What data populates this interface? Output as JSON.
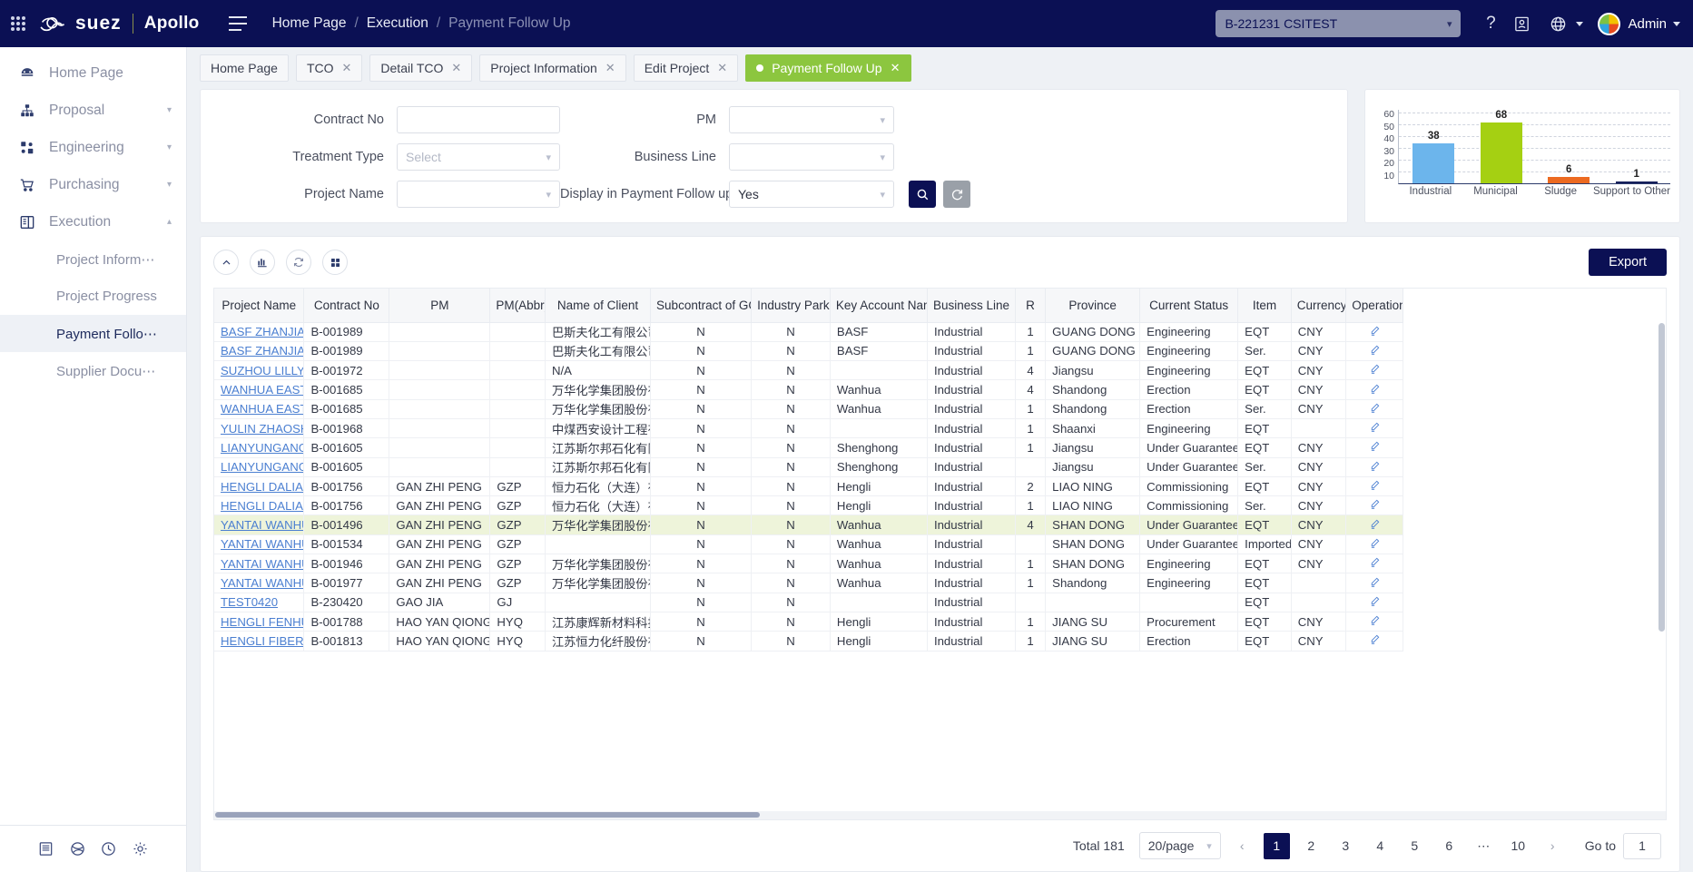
{
  "header": {
    "brand_suez": "suez",
    "brand_apollo": "Apollo",
    "breadcrumb": [
      "Home Page",
      "Execution",
      "Payment Follow Up"
    ],
    "project_selector": "B-221231 CSITEST",
    "user_name": "Admin"
  },
  "tabs": [
    {
      "label": "Home Page",
      "closable": false,
      "active": false
    },
    {
      "label": "TCO",
      "closable": true,
      "active": false
    },
    {
      "label": "Detail TCO",
      "closable": true,
      "active": false
    },
    {
      "label": "Project Information",
      "closable": true,
      "active": false
    },
    {
      "label": "Edit Project",
      "closable": true,
      "active": false
    },
    {
      "label": "Payment Follow Up",
      "closable": true,
      "active": true
    }
  ],
  "sidebar": {
    "items": [
      {
        "label": "Home Page",
        "icon": "dashboard-icon",
        "expandable": false
      },
      {
        "label": "Proposal",
        "icon": "hierarchy-icon",
        "expandable": true,
        "expanded": false
      },
      {
        "label": "Engineering",
        "icon": "nodes-icon",
        "expandable": true,
        "expanded": false
      },
      {
        "label": "Purchasing",
        "icon": "cart-icon",
        "expandable": true,
        "expanded": false
      },
      {
        "label": "Execution",
        "icon": "panel-icon",
        "expandable": true,
        "expanded": true
      }
    ],
    "sub_items": [
      {
        "label": "Project Inform⋯",
        "active": false
      },
      {
        "label": "Project Progress",
        "active": false
      },
      {
        "label": "Payment Follo⋯",
        "active": true
      },
      {
        "label": "Supplier Docu⋯",
        "active": false
      }
    ],
    "bottom_icons": [
      "book-icon",
      "globe-network-icon",
      "clock-icon",
      "gear-icon"
    ]
  },
  "filters": {
    "contract_no": {
      "label": "Contract No",
      "value": "",
      "placeholder": ""
    },
    "treatment_type": {
      "label": "Treatment Type",
      "value": "",
      "placeholder": "Select"
    },
    "project_name": {
      "label": "Project Name",
      "value": "",
      "placeholder": ""
    },
    "pm": {
      "label": "PM",
      "value": "",
      "placeholder": ""
    },
    "business_line": {
      "label": "Business Line",
      "value": "",
      "placeholder": ""
    },
    "display_in_payment_follow_up": {
      "label": "Display in Payment Follow up",
      "value": "Yes"
    },
    "search_icon": "search-icon",
    "reset_icon": "reset-icon"
  },
  "chart_data": {
    "type": "bar",
    "title": "",
    "categories": [
      "Industrial",
      "Municipal",
      "Sludge",
      "Support to Other"
    ],
    "values": [
      38,
      68,
      6,
      1
    ],
    "colors": [
      "#6cb5ec",
      "#a5d012",
      "#ec6a21",
      "#16205c"
    ],
    "ylim": [
      0,
      70
    ],
    "yticks": [
      60,
      50,
      40,
      30,
      20,
      10
    ],
    "xlabel": "",
    "ylabel": "",
    "grid": true,
    "legend": "none"
  },
  "table_toolbar": {
    "collapse_icon": "chevron-up-icon",
    "chart_icon": "bar-chart-icon",
    "refresh_icon": "refresh-icon",
    "columns_icon": "grid-columns-icon",
    "export_label": "Export"
  },
  "table": {
    "columns": [
      "Project Name",
      "Contract No",
      "PM",
      "PM(Abbr)",
      "Name of Client",
      "Subcontract of GC",
      "Industry Park",
      "Key Account Name",
      "Business Line",
      "R",
      "Province",
      "Current Status",
      "Item",
      "Currency",
      "Operation"
    ],
    "rows": [
      {
        "highlight": false,
        "cells": [
          "BASF ZHANJIANG N",
          "B-001989",
          "",
          "",
          "巴斯夫化工有限公司",
          "N",
          "N",
          "BASF",
          "Industrial",
          "1",
          "GUANG DONG",
          "Engineering",
          "EQT",
          "CNY",
          "edit-icon"
        ]
      },
      {
        "highlight": false,
        "cells": [
          "BASF ZHANJIANG N",
          "B-001989",
          "",
          "",
          "巴斯夫化工有限公司",
          "N",
          "N",
          "BASF",
          "Industrial",
          "1",
          "GUANG DONG",
          "Engineering",
          "Ser.",
          "CNY",
          "edit-icon"
        ]
      },
      {
        "highlight": false,
        "cells": [
          "SUZHOU LILLY PHAR",
          "B-001972",
          "",
          "",
          "N/A",
          "N",
          "N",
          "",
          "Industrial",
          "4",
          "Jiangsu",
          "Engineering",
          "EQT",
          "CNY",
          "edit-icon"
        ]
      },
      {
        "highlight": false,
        "cells": [
          "WANHUA EAST AND",
          "B-001685",
          "",
          "",
          "万华化学集团股份有",
          "N",
          "N",
          "Wanhua",
          "Industrial",
          "4",
          "Shandong",
          "Erection",
          "EQT",
          "CNY",
          "edit-icon"
        ]
      },
      {
        "highlight": false,
        "cells": [
          "WANHUA EAST AND",
          "B-001685",
          "",
          "",
          "万华化学集团股份有",
          "N",
          "N",
          "Wanhua",
          "Industrial",
          "1",
          "Shandong",
          "Erection",
          "Ser.",
          "CNY",
          "edit-icon"
        ]
      },
      {
        "highlight": false,
        "cells": [
          "YULIN ZHAOSHIPAN",
          "B-001968",
          "",
          "",
          "中煤西安设计工程有",
          "N",
          "N",
          "",
          "Industrial",
          "1",
          "Shaanxi",
          "Engineering",
          "EQT",
          "",
          "edit-icon"
        ]
      },
      {
        "highlight": false,
        "cells": [
          "  LIANYUNGANG SIE",
          "B-001605",
          "",
          "",
          "江苏斯尔邦石化有限",
          "N",
          "N",
          "Shenghong",
          "Industrial",
          "1",
          "Jiangsu",
          "Under Guarantee",
          "EQT",
          "CNY",
          "edit-icon"
        ]
      },
      {
        "highlight": false,
        "cells": [
          "  LIANYUNGANG SIE",
          "B-001605",
          "",
          "",
          "江苏斯尔邦石化有限",
          "N",
          "N",
          "Shenghong",
          "Industrial",
          "",
          "Jiangsu",
          "Under Guarantee",
          "Ser.",
          "CNY",
          "edit-icon"
        ]
      },
      {
        "highlight": false,
        "cells": [
          "HENGLI DALIAN PTA",
          "B-001756",
          "GAN ZHI PENG",
          "GZP",
          "恒力石化（大连）有",
          "N",
          "N",
          "Hengli",
          "Industrial",
          "2",
          "LIAO NING",
          "Commissioning",
          "EQT",
          "CNY",
          "edit-icon"
        ]
      },
      {
        "highlight": false,
        "cells": [
          "HENGLI DALIAN PTA",
          "B-001756",
          "GAN ZHI PENG",
          "GZP",
          "恒力石化（大连）有",
          "N",
          "N",
          "Hengli",
          "Industrial",
          "1",
          "LIAO NING",
          "Commissioning",
          "Ser.",
          "CNY",
          "edit-icon"
        ]
      },
      {
        "highlight": true,
        "cells": [
          "YANTAI WANHUA II",
          "B-001496",
          "GAN ZHI PENG",
          "GZP",
          "万华化学集团股份有",
          "N",
          "N",
          "Wanhua",
          "Industrial",
          "4",
          "SHAN DONG",
          "Under Guarantee",
          "EQT",
          "CNY",
          "edit-icon"
        ]
      },
      {
        "highlight": false,
        "cells": [
          "YANTAI WANHUA II",
          "B-001534",
          "GAN ZHI PENG",
          "GZP",
          "",
          "N",
          "N",
          "Wanhua",
          "Industrial",
          "",
          "SHAN DONG",
          "Under Guarantee",
          "Imported",
          "CNY",
          "edit-icon"
        ]
      },
      {
        "highlight": false,
        "cells": [
          "YANTAI WANHUA PE",
          "B-001946",
          "GAN ZHI PENG",
          "GZP",
          "万华化学集团股份有",
          "N",
          "N",
          "Wanhua",
          "Industrial",
          "1",
          "SHAN DONG",
          "Engineering",
          "EQT",
          "CNY",
          "edit-icon"
        ]
      },
      {
        "highlight": false,
        "cells": [
          "YANTAI WANHUA PE",
          "B-001977",
          "GAN ZHI PENG",
          "GZP",
          "万华化学集团股份有",
          "N",
          "N",
          "Wanhua",
          "Industrial",
          "1",
          "Shandong",
          "Engineering",
          "EQT",
          "",
          "edit-icon"
        ]
      },
      {
        "highlight": false,
        "cells": [
          "TEST0420",
          "B-230420",
          "GAO JIA",
          "GJ",
          "",
          "N",
          "N",
          "",
          "Industrial",
          "",
          "",
          "",
          "EQT",
          "",
          "edit-icon"
        ]
      },
      {
        "highlight": false,
        "cells": [
          "HENGLI FENHU BOP",
          "B-001788",
          "HAO YAN QIONG",
          "HYQ",
          "江苏康辉新材料科技",
          "N",
          "N",
          "Hengli",
          "Industrial",
          "1",
          "JIANG SU",
          "Procurement",
          "EQT",
          "CNY",
          "edit-icon"
        ]
      },
      {
        "highlight": false,
        "cells": [
          "HENGLI FIBER",
          "B-001813",
          "HAO YAN QIONG",
          "HYQ",
          "江苏恒力化纤股份有",
          "N",
          "N",
          "Hengli",
          "Industrial",
          "1",
          "JIANG SU",
          "Erection",
          "EQT",
          "CNY",
          "edit-icon"
        ]
      }
    ]
  },
  "pagination": {
    "total_label": "Total 181",
    "page_size": "20/page",
    "prev_icon": "chevron-left-icon",
    "next_icon": "chevron-right-icon",
    "pages": [
      "1",
      "2",
      "3",
      "4",
      "5",
      "6",
      "⋯",
      "10"
    ],
    "current_page": "1",
    "goto_label": "Go to",
    "goto_value": "1"
  },
  "colors": {
    "brand_navy": "#0b1054",
    "accent_green": "#8cc63f",
    "link_blue": "#4b7fd1",
    "row_highlight": "#eef4da"
  }
}
